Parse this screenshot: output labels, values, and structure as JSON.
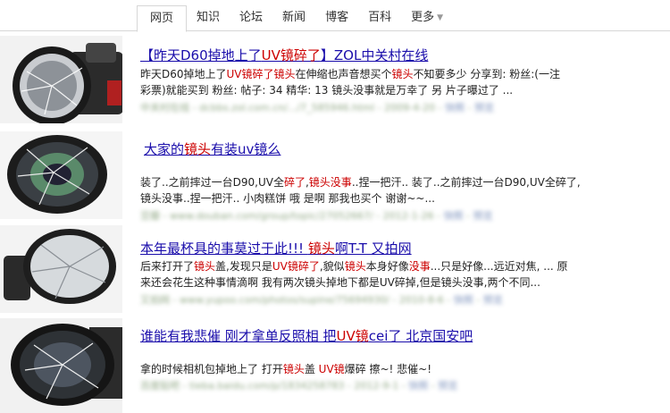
{
  "nav": {
    "tabs": [
      "网页",
      "知识",
      "论坛",
      "新闻",
      "博客",
      "百科"
    ],
    "more": "更多"
  },
  "results": [
    {
      "title_parts": [
        {
          "t": "【昨天D60掉地上了"
        },
        {
          "t": "UV镜碎了",
          "hl": true
        },
        {
          "t": "】ZOL中关村在线"
        }
      ],
      "snippet": [
        [
          {
            "t": "昨天D60掉地上了"
          },
          {
            "t": "UV镜碎了镜头",
            "hl": true
          },
          {
            "t": "在伸缩也声音想买个"
          },
          {
            "t": "镜头",
            "hl": true
          },
          {
            "t": "不知要多少 分享到: 粉丝:(一注"
          }
        ],
        [
          {
            "t": "彩票)就能买到 粉丝: 帖子: 34 精华: 13 镜头没事就是万幸了 另 片子曝过了 ..."
          }
        ]
      ],
      "url": "中关村在线 - dcbbs.zol.com.cn/.../7_585946.html - 2009-4-20",
      "links": [
        "快照",
        "预览"
      ]
    },
    {
      "title_parts": [
        {
          "t": "大家的"
        },
        {
          "t": "镜头",
          "hl": true
        },
        {
          "t": "有装uv镜么"
        }
      ],
      "snippet": [
        [
          {
            "t": "装了..之前摔过一台D90,UV全"
          },
          {
            "t": "碎了",
            "hl": true
          },
          {
            "t": ","
          },
          {
            "t": "镜头没事",
            "hl": true
          },
          {
            "t": "..捏一把汗.. 装了..之前摔过一台D90,UV全碎了,"
          }
        ],
        [
          {
            "t": "镜头没事..捏一把汗.. 小肉糕饼 哦 是啊 那我也买个 谢谢~~..."
          }
        ]
      ],
      "url": "豆瓣 - www.douban.com/group/topic/27052667/ - 2012-1-26",
      "links": [
        "快照",
        "预览"
      ]
    },
    {
      "title_parts": [
        {
          "t": "本年最杯具的事莫过于此!!! "
        },
        {
          "t": "镜头",
          "hl": true
        },
        {
          "t": "啊T-T 又拍网"
        }
      ],
      "snippet": [
        [
          {
            "t": "后来打开了"
          },
          {
            "t": "镜头",
            "hl": true
          },
          {
            "t": "盖,发现只是"
          },
          {
            "t": "UV镜碎了",
            "hl": true
          },
          {
            "t": ",貌似"
          },
          {
            "t": "镜头",
            "hl": true
          },
          {
            "t": "本身好像"
          },
          {
            "t": "没事",
            "hl": true
          },
          {
            "t": "...只是好像...远近对焦, ... 原"
          }
        ],
        [
          {
            "t": "来还会花生这种事情滴啊 我有两次镜头掉地下都是UV碎掉,但是镜头没事,两个不同..."
          }
        ]
      ],
      "url": "又拍网 - www.yupoo.com/photos/supine/75694930/ - 2010-8-6",
      "links": [
        "快照",
        "预览"
      ]
    },
    {
      "title_parts": [
        {
          "t": "谁能有我悲催 刚才拿单反照相 把"
        },
        {
          "t": "UV镜",
          "hl": true
        },
        {
          "t": "cei了 北京国安吧"
        }
      ],
      "snippet": [
        [
          {
            "t": "拿的时候相机包掉地上了 打开"
          },
          {
            "t": "镜头",
            "hl": true
          },
          {
            "t": "盖 "
          },
          {
            "t": "UV镜",
            "hl": true
          },
          {
            "t": "爆碎 擦~! 悲催~!"
          }
        ]
      ],
      "url": "百度贴吧 - tieba.baidu.com/p/1834258783 - 2012-9-1",
      "links": [
        "快照",
        "预览"
      ]
    }
  ]
}
